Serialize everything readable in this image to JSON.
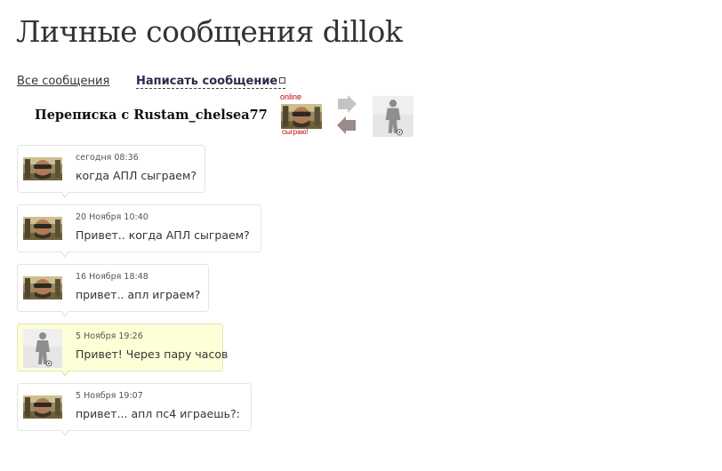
{
  "page": {
    "title": "Личные сообщения dillok"
  },
  "nav": {
    "all_messages": "Все сообщения",
    "write_message": "Написать сообщение"
  },
  "conversation": {
    "title": "Переписка с Rustam_chelsea77",
    "partner_status": "online",
    "partner_caption": "сыграю!"
  },
  "messages": [
    {
      "author": "partner",
      "time": "сегодня 08:36",
      "text": "когда АПЛ сыграем?"
    },
    {
      "author": "partner",
      "time": "20 Ноября 10:40",
      "text": "Привет.. когда АПЛ сыграем?"
    },
    {
      "author": "partner",
      "time": "16 Ноября 18:48",
      "text": "привет.. апл играем?"
    },
    {
      "author": "self",
      "time": "5 Ноября 19:26",
      "text": "Привет! Через пару часов"
    },
    {
      "author": "partner",
      "time": "5 Ноября 19:07",
      "text": "привет... апл пс4 играешь?:"
    }
  ],
  "colors": {
    "own_message_bg": "#ffffd7",
    "online": "#c00000"
  },
  "icons": {
    "swap": "swap-arrows-icon",
    "external": "external-link-icon"
  }
}
